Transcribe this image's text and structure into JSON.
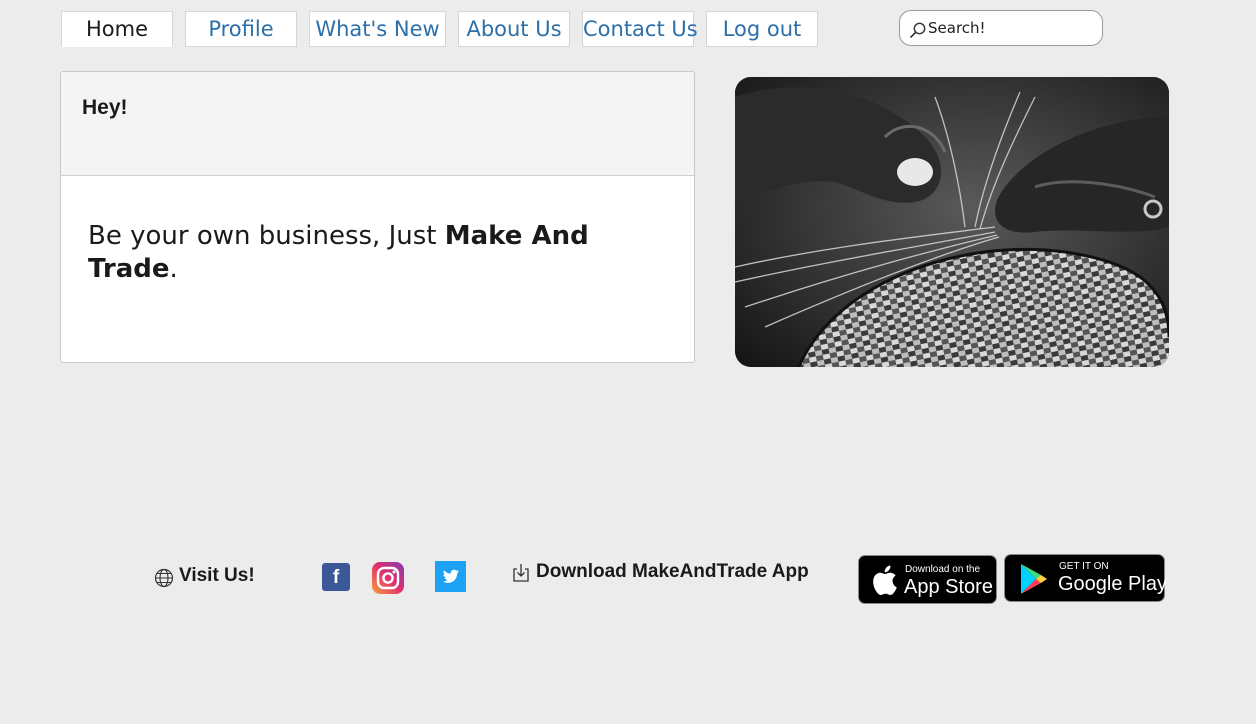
{
  "nav": {
    "tabs": [
      {
        "label": "Home",
        "active": true
      },
      {
        "label": "Profile",
        "active": false
      },
      {
        "label": "What's New",
        "active": false
      },
      {
        "label": "About Us",
        "active": false
      },
      {
        "label": "Contact Us",
        "active": false
      },
      {
        "label": "Log out",
        "active": false
      }
    ]
  },
  "search": {
    "placeholder": "Search!"
  },
  "card": {
    "title": "Hey!",
    "tagline_prefix": "Be your own business, Just ",
    "tagline_brand": "Make And Trade",
    "tagline_suffix": "."
  },
  "hero": {
    "icon": "basket-weaving-photo"
  },
  "footer": {
    "visit_label": "Visit Us!",
    "download_label": "Download MakeAndTrade App",
    "social": {
      "facebook": "f"
    },
    "app_store": {
      "small": "Download on the",
      "big": "App Store"
    },
    "google_play": {
      "small": "GET IT ON",
      "big": "Google Play"
    }
  },
  "colors": {
    "nav_link": "#2d6fa8",
    "background": "#ececec",
    "facebook": "#3b5998",
    "twitter": "#1da1f2"
  }
}
